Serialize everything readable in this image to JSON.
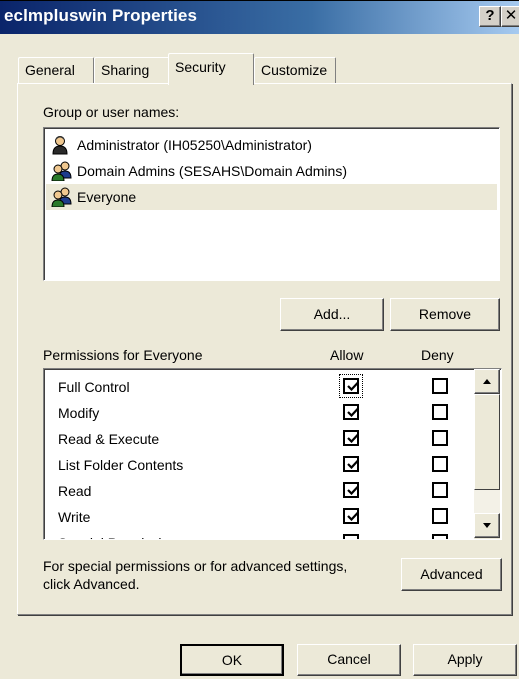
{
  "window": {
    "title": "eclmpluswin Properties",
    "help_label": "?",
    "close_label": "✕"
  },
  "tabs": [
    {
      "label": "General"
    },
    {
      "label": "Sharing"
    },
    {
      "label": "Security",
      "active": true
    },
    {
      "label": "Customize"
    }
  ],
  "security": {
    "group_label": "Group or user names:",
    "users": [
      {
        "name": "Administrator (IH05250\\Administrator)",
        "icon": "single-user-icon"
      },
      {
        "name": "Domain Admins (SESAHS\\Domain Admins)",
        "icon": "group-users-icon"
      },
      {
        "name": "Everyone",
        "icon": "group-users-icon",
        "selected": true
      }
    ],
    "add_label": "Add...",
    "remove_label": "Remove",
    "permissions_label": "Permissions for Everyone",
    "allow_header": "Allow",
    "deny_header": "Deny",
    "permissions": [
      {
        "name": "Full Control",
        "allow": true,
        "deny": false
      },
      {
        "name": "Modify",
        "allow": true,
        "deny": false
      },
      {
        "name": "Read & Execute",
        "allow": true,
        "deny": false
      },
      {
        "name": "List Folder Contents",
        "allow": true,
        "deny": false
      },
      {
        "name": "Read",
        "allow": true,
        "deny": false
      },
      {
        "name": "Write",
        "allow": true,
        "deny": false
      },
      {
        "name": "Special Permissions",
        "allow": false,
        "deny": false
      }
    ],
    "advanced_text_line1": "For special permissions or for advanced settings,",
    "advanced_text_line2": "click Advanced.",
    "advanced_label": "Advanced"
  },
  "footer": {
    "ok_label": "OK",
    "cancel_label": "Cancel",
    "apply_label": "Apply"
  },
  "colors": {
    "titlebar_start": "#0a246a",
    "titlebar_end": "#a6caf0",
    "dialog_bg": "#ece9d8"
  }
}
